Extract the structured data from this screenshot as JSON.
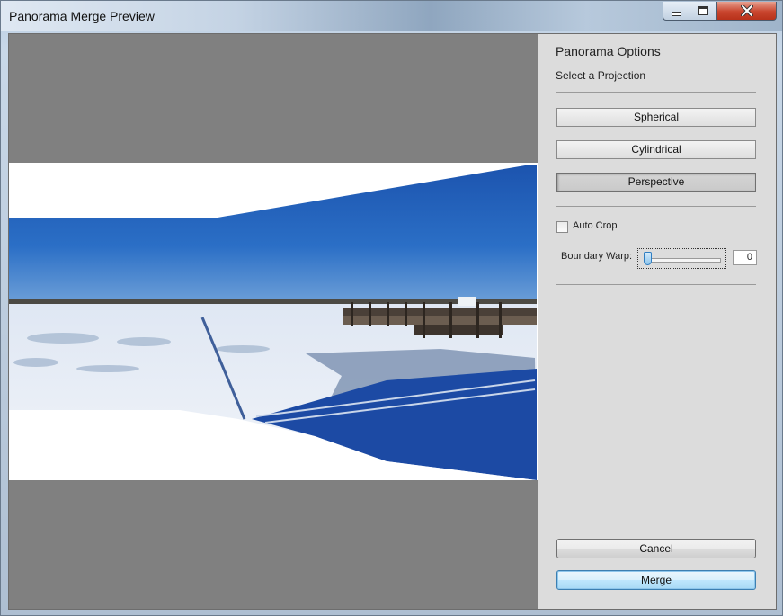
{
  "window": {
    "title": "Panorama Merge Preview"
  },
  "panel": {
    "title": "Panorama Options",
    "projection_label": "Select a Projection",
    "projections": [
      {
        "label": "Spherical",
        "selected": false
      },
      {
        "label": "Cylindrical",
        "selected": false
      },
      {
        "label": "Perspective",
        "selected": true
      }
    ],
    "auto_crop": {
      "label": "Auto Crop",
      "checked": false
    },
    "boundary_warp": {
      "label": "Boundary Warp:",
      "value": "0",
      "min": 0,
      "max": 100
    }
  },
  "actions": {
    "cancel_label": "Cancel",
    "merge_label": "Merge"
  },
  "preview": {
    "content": "frozen lake panorama with pier",
    "colors": {
      "sky": "#1f5fb8",
      "ice": "#e9eef6",
      "water": "#1a47a0",
      "canvas": "#808080"
    }
  }
}
